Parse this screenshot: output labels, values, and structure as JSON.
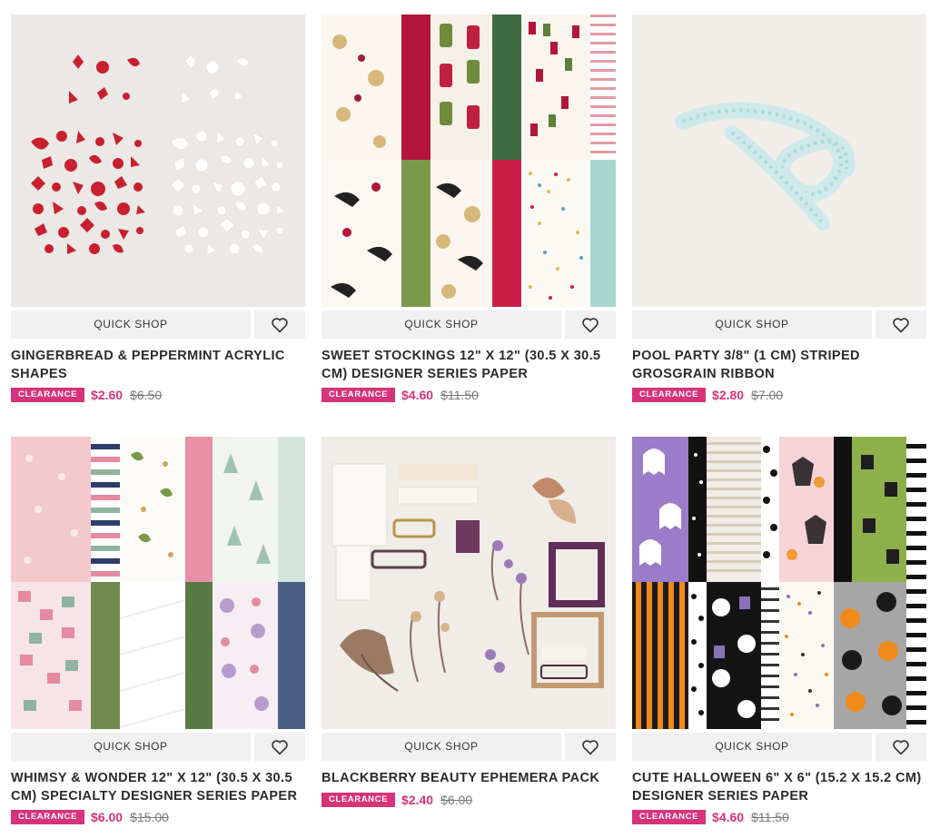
{
  "quick_shop_label": "QUICK SHOP",
  "badge_label": "CLEARANCE",
  "colors": {
    "accent": "#d6337a",
    "button_bg": "#f1f1f1"
  },
  "products": [
    {
      "title": "GINGERBREAD & PEPPERMINT ACRYLIC SHAPES",
      "sale_price": "$2.60",
      "original_price": "$6.50"
    },
    {
      "title": "SWEET STOCKINGS 12\" X 12\" (30.5 X 30.5 CM) DESIGNER SERIES PAPER",
      "sale_price": "$4.60",
      "original_price": "$11.50"
    },
    {
      "title": "POOL PARTY 3/8\" (1 CM) STRIPED GROSGRAIN RIBBON",
      "sale_price": "$2.80",
      "original_price": "$7.00"
    },
    {
      "title": "WHIMSY & WONDER 12\" X 12\" (30.5 X 30.5 CM) SPECIALTY DESIGNER SERIES PAPER",
      "sale_price": "$6.00",
      "original_price": "$15.00"
    },
    {
      "title": "BLACKBERRY BEAUTY EPHEMERA PACK",
      "sale_price": "$2.40",
      "original_price": "$6.00"
    },
    {
      "title": "CUTE HALLOWEEN 6\" X 6\" (15.2 X 15.2 CM) DESIGNER SERIES PAPER",
      "sale_price": "$4.60",
      "original_price": "$11.50"
    }
  ]
}
